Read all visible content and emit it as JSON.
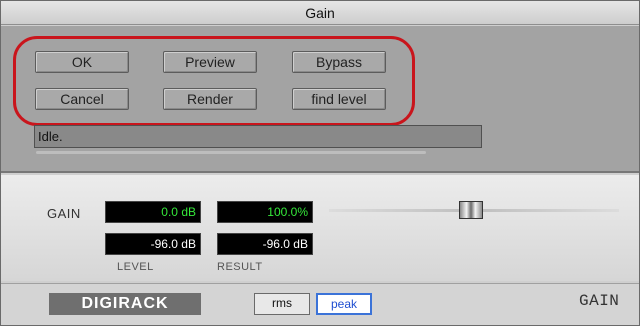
{
  "window": {
    "title": "Gain"
  },
  "buttons": {
    "ok": "OK",
    "preview": "Preview",
    "bypass": "Bypass",
    "cancel": "Cancel",
    "render": "Render",
    "find_level": "find level"
  },
  "status": {
    "text": "Idle."
  },
  "gain": {
    "label": "GAIN",
    "value": "0.0 dB",
    "percent": "100.0%",
    "level_value": "-96.0 dB",
    "result_value": "-96.0 dB",
    "level_label": "LEVEL",
    "result_label": "RESULT"
  },
  "footer": {
    "brand": "DIGIRACK",
    "rms": "rms",
    "peak": "peak",
    "plugin": "GAIN"
  },
  "colors": {
    "highlight": "#c9151c",
    "readout_green": "#35e83a",
    "peak_active": "#1f4fd1"
  }
}
